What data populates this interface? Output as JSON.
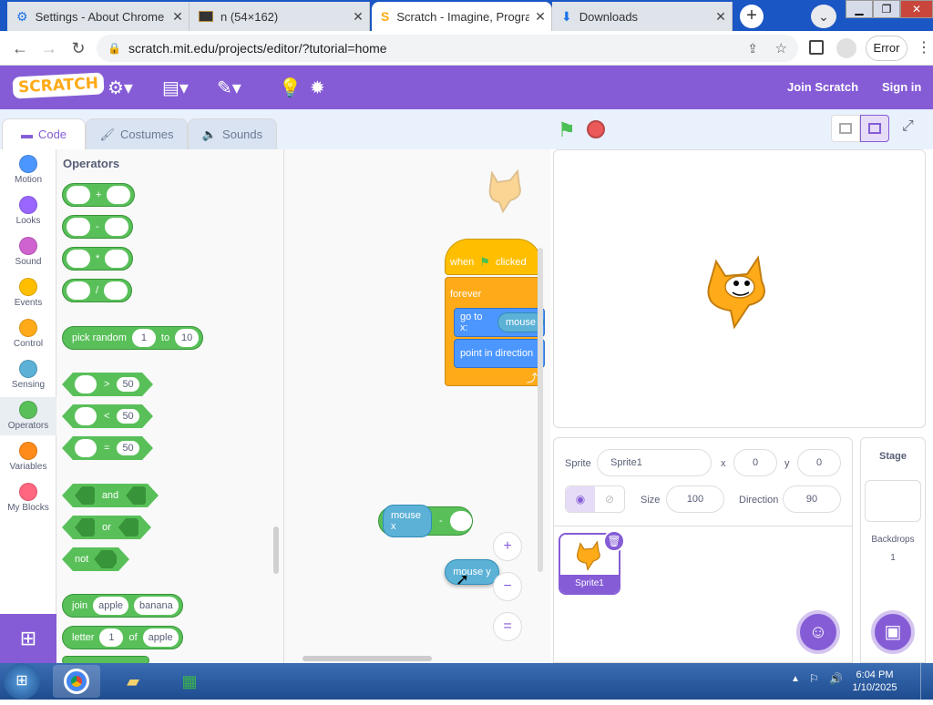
{
  "browser": {
    "tabs": [
      {
        "title": "Settings - About Chrome",
        "icon": "gear-icon"
      },
      {
        "title": "n (54×162)",
        "icon": "image-icon"
      },
      {
        "title": "Scratch - Imagine, Progra",
        "icon": "scratch-icon"
      },
      {
        "title": "Downloads",
        "icon": "download-icon"
      }
    ],
    "url": "scratch.mit.edu/projects/editor/?tutorial=home",
    "error_label": "Error"
  },
  "menu": {
    "logo": "SCRATCH",
    "join": "Join Scratch",
    "signin": "Sign in"
  },
  "editor_tabs": {
    "code": "Code",
    "costumes": "Costumes",
    "sounds": "Sounds"
  },
  "categories": [
    {
      "label": "Motion",
      "color": "#4c97ff"
    },
    {
      "label": "Looks",
      "color": "#9966ff"
    },
    {
      "label": "Sound",
      "color": "#cf63cf"
    },
    {
      "label": "Events",
      "color": "#ffbf00"
    },
    {
      "label": "Control",
      "color": "#ffab19"
    },
    {
      "label": "Sensing",
      "color": "#5cb1d6"
    },
    {
      "label": "Operators",
      "color": "#59c059"
    },
    {
      "label": "Variables",
      "color": "#ff8c1a"
    },
    {
      "label": "My Blocks",
      "color": "#ff6680"
    }
  ],
  "palette": {
    "title": "Operators",
    "arith": [
      "+",
      "-",
      "*",
      "/"
    ],
    "pick_random": {
      "label": "pick random",
      "from": "1",
      "to_label": "to",
      "to": "10"
    },
    "compare": [
      {
        "op": ">",
        "val": "50"
      },
      {
        "op": "<",
        "val": "50"
      },
      {
        "op": "=",
        "val": "50"
      }
    ],
    "logic": [
      "and",
      "or",
      "not"
    ],
    "join": {
      "label": "join",
      "a": "apple",
      "b": "banana"
    },
    "letter": {
      "label": "letter",
      "n": "1",
      "of_label": "of",
      "word": "apple"
    }
  },
  "code": {
    "when_label": "when",
    "clicked_label": "clicked",
    "forever_label": "forever",
    "goto_label": "go to x:",
    "mouse_label": "mouse",
    "point_label": "point in direction",
    "mouse_x": "mouse x",
    "minus": "-",
    "mouse_y": "mouse y",
    "zoom_in": "+",
    "zoom_out": "−",
    "zoom_reset": "="
  },
  "sprite": {
    "label": "Sprite",
    "name": "Sprite1",
    "x_label": "x",
    "x": "0",
    "y_label": "y",
    "y": "0",
    "size_label": "Size",
    "size": "100",
    "direction_label": "Direction",
    "direction": "90",
    "thumb_name": "Sprite1"
  },
  "stage_pane": {
    "title": "Stage",
    "backdrops_label": "Backdrops",
    "backdrops": "1"
  },
  "taskbar": {
    "time": "6:04 PM",
    "date": "1/10/2025"
  },
  "colors": {
    "accent": "#855cd6",
    "operators": "#59c059",
    "motion": "#4c97ff",
    "events": "#ffbf00",
    "control": "#ffab19",
    "sensing": "#5cb1d6"
  }
}
